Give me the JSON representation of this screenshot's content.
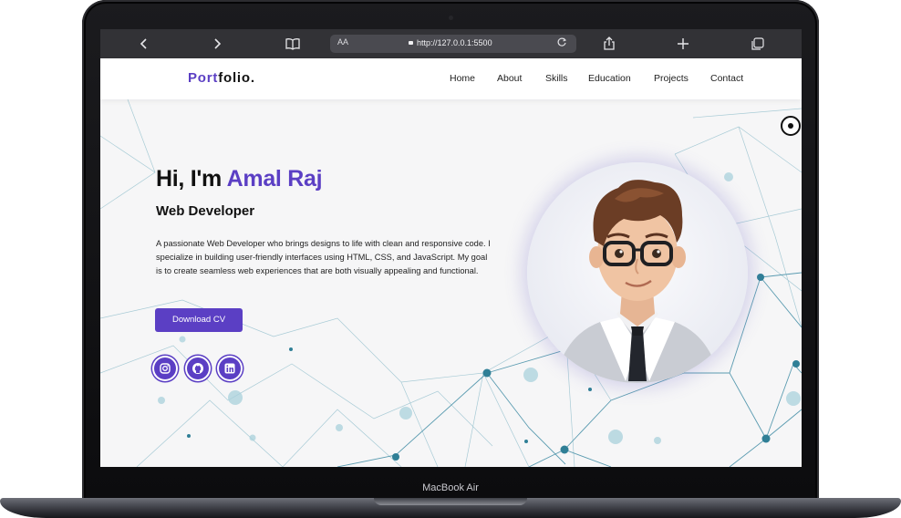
{
  "device": {
    "label": "MacBook Air"
  },
  "browser": {
    "url": "http://127.0.0.1:5500",
    "text_size_label": "AA",
    "icons": [
      "back-icon",
      "forward-icon",
      "bookmarks-icon",
      "reload-icon",
      "share-icon",
      "new-tab-icon",
      "tabs-icon"
    ]
  },
  "site": {
    "logo": {
      "accent": "Port",
      "rest": "folio."
    },
    "nav": [
      "Home",
      "About",
      "Skills",
      "Education",
      "Projects",
      "Contact"
    ],
    "hero": {
      "greeting": "Hi, I'm ",
      "name": "Amal Raj",
      "role": "Web Developer",
      "bio": "A passionate Web Developer who brings designs to life with clean and responsive code. I specialize in building user-friendly interfaces using HTML, CSS, and JavaScript. My goal is to create seamless web experiences that are both visually appealing and functional.",
      "cta": "Download CV"
    },
    "social": [
      "instagram-icon",
      "github-icon",
      "linkedin-icon"
    ],
    "colors": {
      "accent": "#5b3fc4",
      "network": "#2f7f96",
      "background": "#f6f6f7"
    }
  }
}
